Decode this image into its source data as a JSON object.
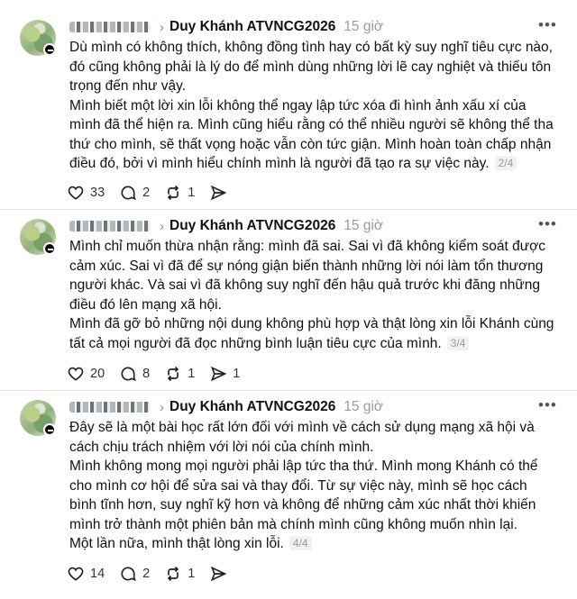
{
  "posts": [
    {
      "reply_to": "Duy Khánh ATVNCG2026",
      "time": "15 giờ",
      "paragraphs": [
        "Dù mình có không thích, không đồng tình hay có bất kỳ suy nghĩ tiêu cực nào, đó cũng không phải là lý do để mình dùng những lời lẽ cay nghiệt và thiếu tôn trọng đến như vậy.",
        "Mình biết một lời xin lỗi không thể ngay lập tức xóa đi hình ảnh xấu xí của mình đã thể hiện ra. Mình cũng hiểu rằng có thể nhiều người sẽ không thể tha thứ cho mình, sẽ thất vọng hoặc vẫn còn tức giận. Mình hoàn toàn chấp nhận điều đó, bởi vì mình hiểu chính mình là người đã tạo ra sự việc này."
      ],
      "page": "2/4",
      "likes": "33",
      "replies": "2",
      "reposts": "1",
      "shares": ""
    },
    {
      "reply_to": "Duy Khánh ATVNCG2026",
      "time": "15 giờ",
      "paragraphs": [
        "Mình chỉ muốn thừa nhận rằng: mình đã sai. Sai vì đã không kiểm soát được cảm xúc. Sai vì đã để sự nóng giận biến thành những lời nói làm tổn thương người khác. Và sai vì đã không suy nghĩ đến hậu quả trước khi đăng những điều đó lên mạng xã hội.",
        "Mình đã gỡ bỏ những nội dung không phù hợp và thật lòng xin lỗi Khánh cùng tất cả mọi người đã đọc những bình luận tiêu cực của mình."
      ],
      "page": "3/4",
      "likes": "20",
      "replies": "8",
      "reposts": "1",
      "shares": "1"
    },
    {
      "reply_to": "Duy Khánh ATVNCG2026",
      "time": "15 giờ",
      "paragraphs": [
        "Đây sẽ là một bài học rất lớn đối với mình về cách sử dụng mạng xã hội và cách chịu trách nhiệm với lời nói của chính mình.",
        "Mình không mong mọi người phải lập tức tha thứ. Mình mong Khánh có thể cho mình cơ hội để sửa sai và thay đổi. Từ sự việc này, mình sẽ học cách bình tĩnh hơn, suy nghĩ kỹ hơn và không để những cảm xúc nhất thời khiến mình trở thành một phiên bản mà chính mình cũng không muốn nhìn lại.",
        "Một lần nữa, mình thật lòng xin lỗi."
      ],
      "page": "4/4",
      "likes": "14",
      "replies": "2",
      "reposts": "1",
      "shares": ""
    }
  ]
}
